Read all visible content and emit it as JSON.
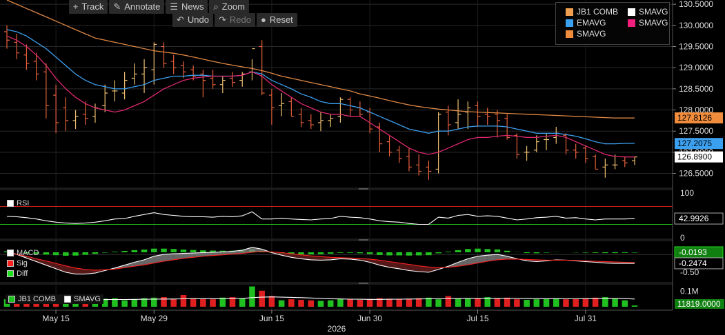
{
  "toolbar": {
    "row1": [
      {
        "icon": "crosshair-icon",
        "glyph": "⌖",
        "label": "Track"
      },
      {
        "icon": "pencil-icon",
        "glyph": "✎",
        "label": "Annotate"
      },
      {
        "icon": "news-icon",
        "glyph": "☰",
        "label": "News"
      },
      {
        "icon": "magnifier-icon",
        "glyph": "⌕",
        "label": "Zoom"
      }
    ],
    "row2": [
      {
        "icon": "undo-icon",
        "glyph": "↶",
        "label": "Undo",
        "disabled": false
      },
      {
        "icon": "redo-icon",
        "glyph": "↷",
        "label": "Redo",
        "disabled": true
      },
      {
        "icon": "reset-icon",
        "glyph": "●",
        "label": "Reset",
        "disabled": false
      }
    ]
  },
  "legend": {
    "items": [
      {
        "label": "JB1 COMB",
        "color": "#f0a050"
      },
      {
        "label": "SMAVG",
        "color": "#ffffff"
      },
      {
        "label": "EMAVG",
        "color": "#3ca0f0"
      },
      {
        "label": "SMAVG",
        "color": "#f0207c"
      },
      {
        "label": "SMAVG",
        "color": "#f08c3c"
      }
    ]
  },
  "x_axis": {
    "ticks": [
      "May 15",
      "May 29",
      "Jun 15",
      "Jun 30",
      "Jul 15",
      "Jul 31"
    ],
    "year": "2026"
  },
  "price_tags": [
    {
      "value": "127.8126",
      "color": "#f08c3c",
      "text_color": "#000000"
    },
    {
      "value": "127.2075",
      "color": "#3ca0f0",
      "text_color": "#000000"
    },
    {
      "value": "126.8900",
      "color": "#ffffff",
      "text_color": "#000000"
    }
  ],
  "rsi_panel": {
    "label": "RSI",
    "levels": [
      "100",
      "0"
    ],
    "current": "42.9926"
  },
  "macd_panel": {
    "labels": [
      {
        "label": "MACD",
        "color": "#ffffff"
      },
      {
        "label": "Sig",
        "color": "#ff2020"
      },
      {
        "label": "Diff",
        "color": "#20e020"
      }
    ],
    "ticks": [
      "-0.50"
    ],
    "tags": [
      {
        "value": "-0.0193",
        "color": "#20e020"
      },
      {
        "value": "-0.2474",
        "color": "#ffffff"
      }
    ]
  },
  "volume_panel": {
    "labels": [
      {
        "label": "JB1 COMB",
        "color": "#20c020"
      },
      {
        "label": "SMAVG",
        "color": "#ffffff"
      }
    ],
    "ticks": [
      "0.1M"
    ],
    "tag": {
      "value": "11819.0000",
      "color": "#20e020"
    }
  },
  "colors": {
    "up": "#f0c070",
    "down": "#e8603c",
    "ema": "#3ca0f0",
    "sma_short": "#e02870",
    "sma_long": "#e08844",
    "rsi": "#ffffff",
    "grid": "#2a2a2a"
  },
  "chart_data": {
    "type": "ohlc",
    "title": "",
    "xlabel": "2026",
    "ylabel": "",
    "ylim": [
      126.2,
      130.6
    ],
    "y_ticks": [
      126.5,
      127.0,
      127.5,
      128.0,
      128.5,
      129.0,
      129.5,
      130.0,
      130.5
    ],
    "dates": [
      "May 8",
      "May 9",
      "May 12",
      "May 13",
      "May 14",
      "May 15",
      "May 16",
      "May 19",
      "May 20",
      "May 21",
      "May 22",
      "May 23",
      "May 26",
      "May 27",
      "May 28",
      "May 29",
      "May 30",
      "Jun 2",
      "Jun 3",
      "Jun 4",
      "Jun 5",
      "Jun 6",
      "Jun 9",
      "Jun 10",
      "Jun 11",
      "Jun 12",
      "Jun 13",
      "Jun 16",
      "Jun 17",
      "Jun 18",
      "Jun 19",
      "Jun 20",
      "Jun 23",
      "Jun 24",
      "Jun 25",
      "Jun 26",
      "Jun 27",
      "Jun 30",
      "Jul 1",
      "Jul 2",
      "Jul 3",
      "Jul 4",
      "Jul 7",
      "Jul 8",
      "Jul 9",
      "Jul 10",
      "Jul 11",
      "Jul 14",
      "Jul 15",
      "Jul 16",
      "Jul 17",
      "Jul 18",
      "Jul 21",
      "Jul 22",
      "Jul 23",
      "Jul 24",
      "Jul 25",
      "Jul 28",
      "Jul 29",
      "Jul 30",
      "Jul 31",
      "Aug 1",
      "Aug 4",
      "Aug 5",
      "Aug 6"
    ],
    "open": [
      129.85,
      129.6,
      129.3,
      129.15,
      128.9,
      128.35,
      128.05,
      127.75,
      127.9,
      127.85,
      128.1,
      128.45,
      128.4,
      128.75,
      128.85,
      128.95,
      129.5,
      129.15,
      129.05,
      128.95,
      128.85,
      128.75,
      128.6,
      128.75,
      128.7,
      128.9,
      129.5,
      128.35,
      128.1,
      128.2,
      127.9,
      127.75,
      127.7,
      127.75,
      127.85,
      128.25,
      128.05,
      127.95,
      127.6,
      127.25,
      127.05,
      126.9,
      126.7,
      126.65,
      126.6,
      127.95,
      127.7,
      127.95,
      128.1,
      127.9,
      127.9,
      127.8,
      127.4,
      127.0,
      127.05,
      127.3,
      127.35,
      127.4,
      127.05,
      127.1,
      126.9,
      126.65,
      126.7,
      126.8,
      126.8
    ],
    "high": [
      130.0,
      129.8,
      129.55,
      129.35,
      129.1,
      128.6,
      128.3,
      128.0,
      128.2,
      128.15,
      128.6,
      128.7,
      128.9,
      129.1,
      129.2,
      129.6,
      129.6,
      129.3,
      129.15,
      129.05,
      128.95,
      128.95,
      128.8,
      128.9,
      128.9,
      129.2,
      129.65,
      128.5,
      128.4,
      128.3,
      128.05,
      127.9,
      127.95,
      127.9,
      128.3,
      128.3,
      128.2,
      128.05,
      127.7,
      127.4,
      127.15,
      127.1,
      126.95,
      126.8,
      127.95,
      128.1,
      128.25,
      128.2,
      128.2,
      128.05,
      128.0,
      127.9,
      127.45,
      127.15,
      127.4,
      127.45,
      127.6,
      127.45,
      127.2,
      127.15,
      126.95,
      126.85,
      126.95,
      126.9,
      126.9
    ],
    "low": [
      129.45,
      129.2,
      128.95,
      128.7,
      127.8,
      127.45,
      127.5,
      127.55,
      127.65,
      127.7,
      127.95,
      128.2,
      128.25,
      128.6,
      128.4,
      128.6,
      129.0,
      128.85,
      128.75,
      128.7,
      128.3,
      128.5,
      128.4,
      128.55,
      128.55,
      128.7,
      128.35,
      127.65,
      127.85,
      127.85,
      127.6,
      127.55,
      127.5,
      127.6,
      127.7,
      127.85,
      127.85,
      127.45,
      127.0,
      126.9,
      126.75,
      126.55,
      126.45,
      126.35,
      126.5,
      127.4,
      127.55,
      127.55,
      127.6,
      127.65,
      127.35,
      127.3,
      126.85,
      126.8,
      127.0,
      127.05,
      127.2,
      126.95,
      126.85,
      126.75,
      126.6,
      126.4,
      126.6,
      126.65,
      126.7
    ],
    "close": [
      129.65,
      129.35,
      129.1,
      128.85,
      128.1,
      127.7,
      127.75,
      127.85,
      127.8,
      128.05,
      128.4,
      128.45,
      128.7,
      128.85,
      129.0,
      129.55,
      129.1,
      129.0,
      128.9,
      128.8,
      128.7,
      128.6,
      128.7,
      128.65,
      128.85,
      129.45,
      128.4,
      128.05,
      128.15,
      127.85,
      127.7,
      127.65,
      127.75,
      127.8,
      128.25,
      128.0,
      127.9,
      127.55,
      127.2,
      127.0,
      126.85,
      126.65,
      126.55,
      126.55,
      127.9,
      127.65,
      127.9,
      128.05,
      127.85,
      127.85,
      127.75,
      127.35,
      126.95,
      127.0,
      127.25,
      127.3,
      127.45,
      127.05,
      127.0,
      126.85,
      126.6,
      126.7,
      126.7,
      126.75,
      126.89
    ],
    "ema": [
      129.9,
      129.85,
      129.75,
      129.6,
      129.45,
      129.25,
      129.05,
      128.85,
      128.7,
      128.6,
      128.55,
      128.5,
      128.5,
      128.55,
      128.6,
      128.7,
      128.75,
      128.8,
      128.8,
      128.82,
      128.82,
      128.8,
      128.8,
      128.8,
      128.82,
      128.9,
      128.85,
      128.7,
      128.6,
      128.5,
      128.38,
      128.3,
      128.2,
      128.15,
      128.15,
      128.1,
      128.05,
      127.95,
      127.85,
      127.75,
      127.65,
      127.55,
      127.5,
      127.45,
      127.5,
      127.5,
      127.55,
      127.6,
      127.62,
      127.62,
      127.62,
      127.6,
      127.55,
      127.5,
      127.45,
      127.45,
      127.45,
      127.42,
      127.38,
      127.32,
      127.25,
      127.2,
      127.2,
      127.21,
      127.21
    ],
    "sma_short": [
      129.75,
      129.65,
      129.5,
      129.3,
      129.05,
      128.75,
      128.5,
      128.3,
      128.15,
      128.05,
      128.0,
      127.95,
      128.0,
      128.1,
      128.2,
      128.35,
      128.5,
      128.6,
      128.7,
      128.75,
      128.78,
      128.8,
      128.8,
      128.8,
      128.82,
      128.9,
      128.8,
      128.6,
      128.45,
      128.3,
      128.15,
      128.05,
      127.95,
      127.9,
      127.9,
      127.85,
      127.85,
      127.7,
      127.55,
      127.4,
      127.25,
      127.1,
      127.0,
      126.95,
      127.0,
      127.1,
      127.2,
      127.3,
      127.35,
      127.35,
      127.38,
      127.4,
      127.38,
      127.35,
      127.35,
      127.38,
      127.4,
      127.35,
      127.25,
      127.15,
      127.05,
      126.95,
      126.9,
      126.89,
      126.89
    ],
    "sma_long": [
      130.6,
      130.5,
      130.4,
      130.3,
      130.2,
      130.1,
      130.0,
      129.9,
      129.8,
      129.7,
      129.65,
      129.6,
      129.55,
      129.5,
      129.45,
      129.4,
      129.37,
      129.34,
      129.3,
      129.25,
      129.2,
      129.15,
      129.1,
      129.06,
      129.02,
      128.98,
      128.93,
      128.87,
      128.8,
      128.75,
      128.7,
      128.65,
      128.6,
      128.55,
      128.5,
      128.45,
      128.38,
      128.33,
      128.28,
      128.22,
      128.17,
      128.12,
      128.08,
      128.05,
      128.02,
      128.0,
      127.98,
      127.96,
      127.95,
      127.94,
      127.93,
      127.92,
      127.91,
      127.9,
      127.89,
      127.88,
      127.87,
      127.86,
      127.85,
      127.84,
      127.83,
      127.82,
      127.81,
      127.81,
      127.81
    ],
    "rsi": {
      "ylim": [
        0,
        100
      ],
      "levels": [
        70,
        30
      ],
      "values": [
        48,
        47,
        45,
        42,
        38,
        35,
        33,
        32,
        33,
        35,
        38,
        42,
        43,
        48,
        52,
        56,
        52,
        50,
        48,
        47,
        47,
        46,
        48,
        47,
        49,
        58,
        42,
        42,
        44,
        42,
        41,
        40,
        42,
        43,
        48,
        46,
        45,
        42,
        38,
        36,
        35,
        32,
        30,
        30,
        46,
        44,
        50,
        52,
        48,
        49,
        48,
        44,
        40,
        42,
        45,
        46,
        48,
        44,
        45,
        42,
        40,
        42,
        42,
        42,
        43
      ]
    },
    "macd": {
      "ylim": [
        -0.75,
        0.35
      ],
      "macd": [
        0.1,
        0.0,
        -0.1,
        -0.2,
        -0.3,
        -0.4,
        -0.5,
        -0.55,
        -0.55,
        -0.52,
        -0.45,
        -0.38,
        -0.3,
        -0.22,
        -0.15,
        -0.05,
        0.0,
        0.02,
        0.03,
        0.04,
        0.05,
        0.06,
        0.07,
        0.09,
        0.12,
        0.2,
        0.15,
        0.05,
        -0.02,
        -0.08,
        -0.12,
        -0.15,
        -0.16,
        -0.15,
        -0.12,
        -0.13,
        -0.16,
        -0.22,
        -0.3,
        -0.36,
        -0.4,
        -0.45,
        -0.48,
        -0.5,
        -0.42,
        -0.33,
        -0.22,
        -0.12,
        -0.05,
        -0.02,
        0.0,
        -0.05,
        -0.12,
        -0.18,
        -0.2,
        -0.18,
        -0.15,
        -0.16,
        -0.18,
        -0.2,
        -0.22,
        -0.24,
        -0.25,
        -0.25,
        -0.25
      ],
      "signal": [
        0.05,
        0.0,
        -0.05,
        -0.12,
        -0.18,
        -0.25,
        -0.32,
        -0.38,
        -0.42,
        -0.44,
        -0.43,
        -0.41,
        -0.37,
        -0.33,
        -0.29,
        -0.24,
        -0.19,
        -0.15,
        -0.11,
        -0.08,
        -0.05,
        -0.03,
        -0.01,
        0.01,
        0.03,
        0.06,
        0.08,
        0.07,
        0.05,
        0.02,
        -0.01,
        -0.04,
        -0.06,
        -0.08,
        -0.09,
        -0.1,
        -0.11,
        -0.13,
        -0.16,
        -0.2,
        -0.24,
        -0.28,
        -0.32,
        -0.35,
        -0.37,
        -0.36,
        -0.33,
        -0.29,
        -0.24,
        -0.19,
        -0.15,
        -0.13,
        -0.13,
        -0.14,
        -0.15,
        -0.16,
        -0.16,
        -0.16,
        -0.17,
        -0.18,
        -0.19,
        -0.2,
        -0.21,
        -0.22,
        -0.23
      ],
      "diff": [
        0.05,
        0.0,
        -0.05,
        -0.08,
        -0.12,
        -0.15,
        -0.18,
        -0.17,
        -0.13,
        -0.08,
        -0.02,
        0.03,
        0.07,
        0.11,
        0.14,
        0.19,
        0.19,
        0.17,
        0.14,
        0.12,
        0.1,
        0.09,
        0.08,
        0.08,
        0.09,
        0.14,
        0.07,
        -0.02,
        -0.07,
        -0.1,
        -0.11,
        -0.11,
        -0.1,
        -0.07,
        -0.03,
        -0.03,
        -0.05,
        -0.09,
        -0.14,
        -0.16,
        -0.16,
        -0.17,
        -0.16,
        -0.15,
        -0.05,
        0.03,
        0.11,
        0.17,
        0.19,
        0.17,
        0.15,
        0.08,
        0.01,
        -0.04,
        -0.05,
        -0.02,
        0.01,
        0.0,
        -0.01,
        -0.02,
        -0.03,
        -0.04,
        -0.04,
        -0.03,
        -0.02
      ]
    },
    "volume": {
      "ylim": [
        0,
        200000
      ],
      "values": [
        70000,
        75000,
        65000,
        80000,
        90000,
        85000,
        70000,
        60000,
        65000,
        70000,
        75000,
        80000,
        60000,
        70000,
        80000,
        85000,
        90000,
        70000,
        110000,
        80000,
        75000,
        70000,
        85000,
        90000,
        80000,
        190000,
        150000,
        100000,
        60000,
        70000,
        65000,
        60000,
        55000,
        60000,
        75000,
        70000,
        65000,
        70000,
        80000,
        75000,
        70000,
        75000,
        80000,
        85000,
        70000,
        100000,
        80000,
        75000,
        80000,
        90000,
        75000,
        85000,
        70000,
        65000,
        70000,
        75000,
        80000,
        70000,
        75000,
        80000,
        85000,
        90000,
        80000,
        60000,
        11819
      ],
      "sma": [
        60000,
        61000,
        62000,
        63000,
        64000,
        65000,
        65000,
        65000,
        65000,
        66000,
        67000,
        68000,
        68000,
        69000,
        70000,
        71000,
        72000,
        72000,
        74000,
        75000,
        75000,
        75000,
        76000,
        77000,
        78000,
        85000,
        90000,
        92000,
        90000,
        88000,
        85000,
        82000,
        78000,
        75000,
        73000,
        71000,
        70000,
        69000,
        69000,
        70000,
        71000,
        72000,
        73000,
        74000,
        74000,
        76000,
        77000,
        78000,
        78000,
        79000,
        79000,
        79000,
        78000,
        77000,
        76000,
        75000,
        75000,
        74000,
        74000,
        75000,
        76000,
        77000,
        77000,
        76000,
        72000
      ]
    }
  }
}
